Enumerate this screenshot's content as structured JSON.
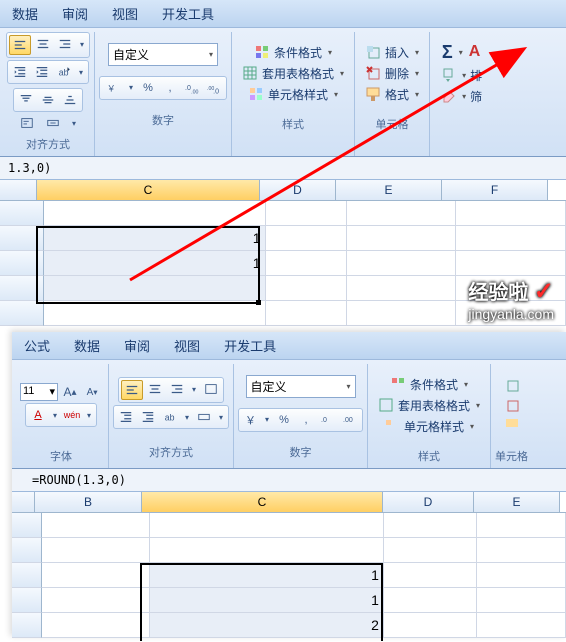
{
  "tabs1": [
    "数据",
    "审阅",
    "视图",
    "开发工具"
  ],
  "tabs2": [
    "公式",
    "数据",
    "审阅",
    "视图",
    "开发工具"
  ],
  "group_labels": {
    "align": "对齐方式",
    "number": "数字",
    "styles": "样式",
    "cells": "单元格",
    "font": "字体"
  },
  "select_custom": "自定义",
  "styles_items": {
    "cond": "条件格式",
    "table": "套用表格格式",
    "cell": "单元格样式"
  },
  "cells_items": {
    "insert": "插入",
    "delete": "删除",
    "format": "格式"
  },
  "font_size": "11",
  "formula1": "1.3,0)",
  "formula2": "=ROUND(1.3,0)",
  "cols1": [
    "C",
    "D",
    "E",
    "F"
  ],
  "col_widths1": [
    222,
    75,
    105,
    105
  ],
  "rows1": [
    [
      "",
      "",
      "",
      ""
    ],
    [
      "1",
      "",
      "",
      ""
    ],
    [
      "1",
      "",
      "",
      ""
    ],
    [
      "",
      "",
      "",
      ""
    ],
    [
      "",
      "",
      "",
      ""
    ]
  ],
  "cols2": [
    "B",
    "C",
    "D",
    "E"
  ],
  "col_widths2": [
    106,
    240,
    90,
    85
  ],
  "rows2": [
    [
      "",
      "",
      "",
      ""
    ],
    [
      "",
      "",
      "",
      ""
    ],
    [
      "",
      "1",
      "",
      ""
    ],
    [
      "",
      "1",
      "",
      ""
    ],
    [
      "",
      "2",
      "",
      ""
    ]
  ],
  "watermark": {
    "brand": "经验啦",
    "url": "jingyanla.com"
  },
  "sort_label": "排",
  "filter_label": "筛"
}
